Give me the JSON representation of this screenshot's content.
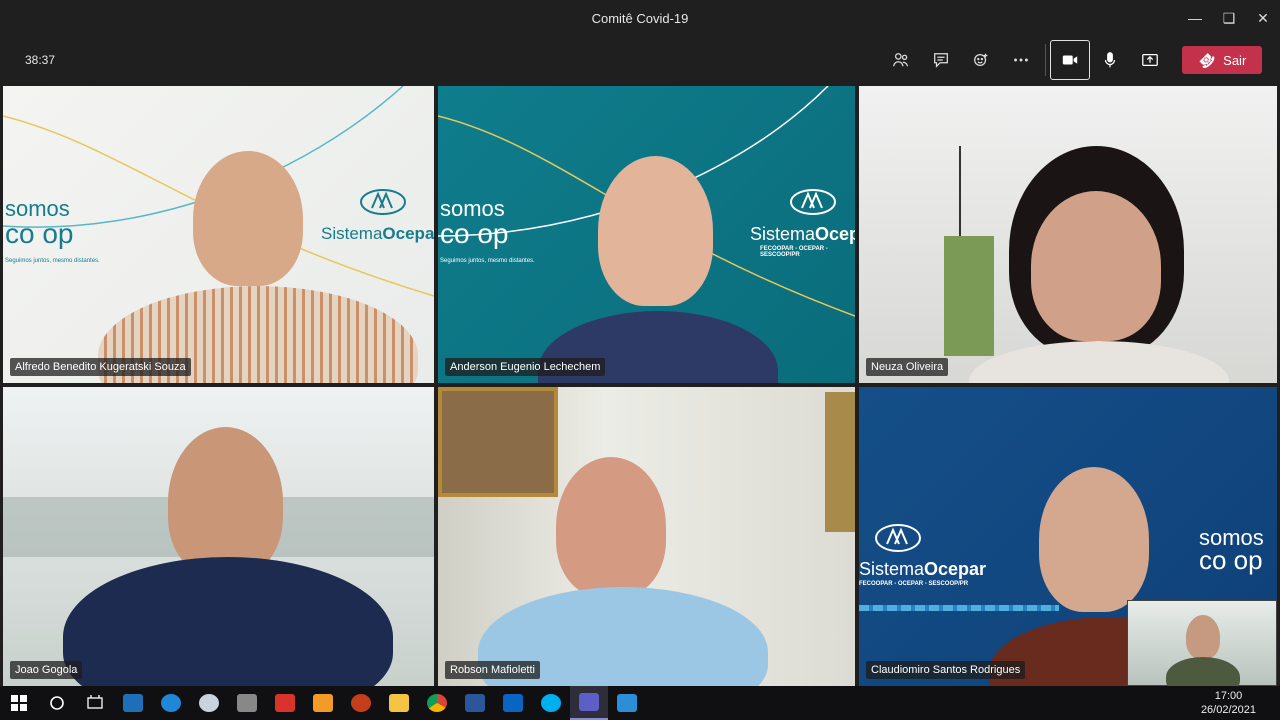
{
  "window": {
    "title": "Comitê Covid-19"
  },
  "toolbar": {
    "timer": "38:37",
    "leave_label": "Sair"
  },
  "participants": [
    {
      "name": "Alfredo Benedito Kugeratski Souza"
    },
    {
      "name": "Anderson Eugenio Lechechem"
    },
    {
      "name": "Neuza Oliveira"
    },
    {
      "name": "Joao Gogola"
    },
    {
      "name": "Robson Mafioletti"
    },
    {
      "name": "Claudiomiro Santos Rodrigues"
    }
  ],
  "branding": {
    "somos": "somos",
    "coop": "co op",
    "sistema": "Sistema",
    "ocepar": "Ocepar",
    "sub": "FECOOPAR - OCEPAR - SESCOOP/PR",
    "slogan": "Seguimos juntos, mesmo distantes."
  },
  "taskbar": {
    "icons": [
      "windows-start",
      "search-circle",
      "task-view",
      "media-player",
      "edge",
      "paint",
      "calculator",
      "antivirus",
      "pdf-tool",
      "powerpoint",
      "file-explorer",
      "chrome",
      "word",
      "outlook",
      "skype",
      "teams",
      "media-app"
    ],
    "time": "17:00",
    "date": "26/02/2021"
  },
  "colors": {
    "leave": "#c4314b",
    "teal": "#0f7d8c",
    "ocepar_blue": "#154f88"
  }
}
